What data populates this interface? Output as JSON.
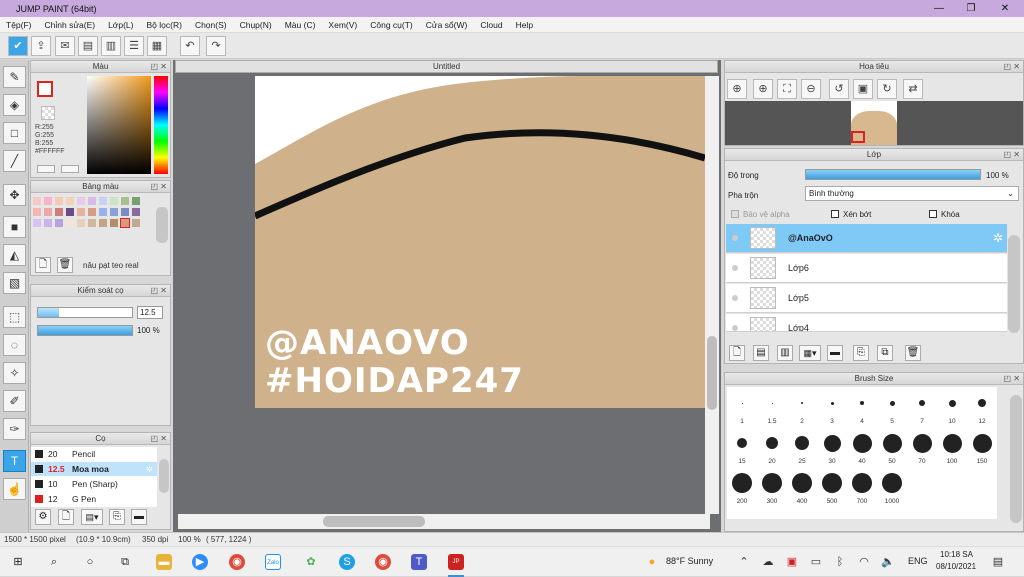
{
  "window": {
    "title": "JUMP PAINT (64bit)",
    "min": "—",
    "max": "❐",
    "close": "✕"
  },
  "menu": [
    "Tệp(F)",
    "Chỉnh sửa(E)",
    "Lớp(L)",
    "Bộ lọc(R)",
    "Chọn(S)",
    "Chụp(N)",
    "Màu (C)",
    "Xem(V)",
    "Công cụ(T)",
    "Cửa sổ(W)",
    "Cloud",
    "Help"
  ],
  "color_panel": {
    "title": "Màu",
    "r": "R:255",
    "g": "G:255",
    "b": "B:255",
    "hex": "#FFFFFF"
  },
  "swatch_panel": {
    "title": "Bảng màu",
    "name": "nâu pạt teo real"
  },
  "size_panel": {
    "title": "Kiểm soát cọ",
    "size": "12.5",
    "opacity": "100 %"
  },
  "brush_panel": {
    "title": "Cọ",
    "items": [
      {
        "size": "20",
        "name": "Pencil",
        "selected": false,
        "color": "#222222"
      },
      {
        "size": "12.5",
        "name": "Moa moa",
        "selected": true,
        "color": "#222222"
      },
      {
        "size": "10",
        "name": "Pen (Sharp)",
        "selected": false,
        "color": "#222222"
      },
      {
        "size": "12",
        "name": "G Pen",
        "selected": false,
        "color": "#e02020"
      }
    ]
  },
  "canvas": {
    "tab": "Untitled",
    "watermark1": "@ANAOVO",
    "watermark2": "#HOIDAP247",
    "skin_color": "#cfb28c"
  },
  "navigator": {
    "title": "Hoa tiêu"
  },
  "layer_panel": {
    "title": "Lớp",
    "opacity_label": "Độ trong",
    "opacity_value": "100 %",
    "blend_label": "Pha trộn",
    "blend_value": "Bình thường",
    "protect_alpha": "Bảo vệ alpha",
    "clip": "Xén bớt",
    "lock": "Khóa",
    "layers": [
      {
        "name": "@AnaOvO",
        "selected": true
      },
      {
        "name": "Lớp6",
        "selected": false
      },
      {
        "name": "Lớp5",
        "selected": false
      },
      {
        "name": "Lớp4",
        "selected": false
      }
    ]
  },
  "brush_size_panel": {
    "title": "Brush Size",
    "sizes": [
      "1",
      "1.5",
      "2",
      "3",
      "4",
      "5",
      "7",
      "10",
      "12",
      "15",
      "20",
      "25",
      "30",
      "40",
      "50",
      "70",
      "100",
      "150",
      "200",
      "300",
      "400",
      "500",
      "700",
      "1000"
    ]
  },
  "status": {
    "size": "1500 * 1500 pixel",
    "cm": "(10.9 * 10.9cm)",
    "dpi": "350 dpi",
    "zoom": "100 %",
    "coords": "( 577, 1224 )"
  },
  "taskbar": {
    "weather": "88°F  Sunny",
    "lang": "ENG",
    "time": "10:18 SA",
    "date": "08/10/2021"
  }
}
